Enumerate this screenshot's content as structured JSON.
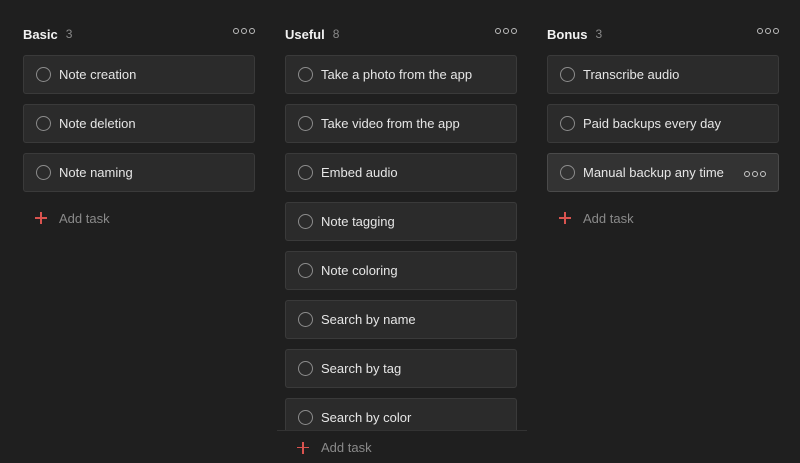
{
  "columns": {
    "basic": {
      "title": "Basic",
      "count": "3",
      "tasks": [
        "Note creation",
        "Note deletion",
        "Note naming"
      ],
      "add_label": "Add task"
    },
    "useful": {
      "title": "Useful",
      "count": "8",
      "tasks": [
        "Take a photo from the app",
        "Take video from the app",
        "Embed audio",
        "Note tagging",
        "Note coloring",
        "Search by name",
        "Search by tag",
        "Search by color"
      ],
      "add_label": "Add task"
    },
    "bonus": {
      "title": "Bonus",
      "count": "3",
      "tasks": [
        "Transcribe audio",
        "Paid backups every day",
        "Manual backup any time"
      ],
      "add_label": "Add task"
    }
  },
  "icons": {
    "task_checkbox": "circle-outline-icon",
    "more": "more-horizontal-icon",
    "add": "plus-icon"
  },
  "colors": {
    "background": "#1f1f1f",
    "card": "#2b2b2b",
    "accent_add": "#d9534f"
  }
}
